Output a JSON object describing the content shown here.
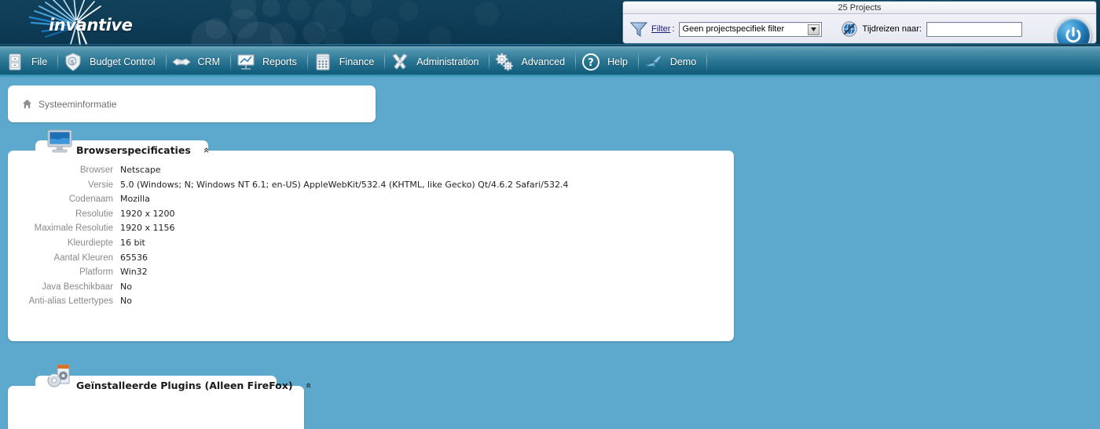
{
  "brand": {
    "name": "invantive"
  },
  "filter_panel": {
    "title": "25 Projects",
    "filter_label": "Filter",
    "colon": ":",
    "filter_value": "Geen projectspecifiek filter",
    "filter_options": [
      "Geen projectspecifiek filter"
    ],
    "timetravel_label": "Tijdreizen naar:",
    "timetravel_value": "",
    "timetravel_placeholder": "",
    "power_title": "Afsluiten"
  },
  "nav": {
    "items": [
      {
        "label": "File",
        "icon": "cabinet-icon"
      },
      {
        "label": "Budget Control",
        "icon": "money-shield-icon"
      },
      {
        "label": "CRM",
        "icon": "handshake-icon"
      },
      {
        "label": "Reports",
        "icon": "presentation-chart-icon"
      },
      {
        "label": "Finance",
        "icon": "calculator-icon"
      },
      {
        "label": "Administration",
        "icon": "tools-icon"
      },
      {
        "label": "Advanced",
        "icon": "gears-icon"
      },
      {
        "label": "Help",
        "icon": "question-circle-icon"
      },
      {
        "label": "Demo",
        "icon": "dolphin-icon"
      }
    ]
  },
  "breadcrumb": {
    "icon": "home-icon",
    "text": "Systeeminformatie"
  },
  "panels": [
    {
      "id": "browser-specs",
      "title": "Browserspecificaties",
      "icon": "monitor-icon",
      "collapse_glyph": "»",
      "rows": [
        {
          "label": "Browser",
          "value": "Netscape"
        },
        {
          "label": "Versie",
          "value": "5.0 (Windows; N; Windows NT 6.1; en-US) AppleWebKit/532.4 (KHTML, like Gecko) Qt/4.6.2 Safari/532.4"
        },
        {
          "label": "Codenaam",
          "value": "Mozilla"
        },
        {
          "label": "Resolutie",
          "value": "1920 x 1200"
        },
        {
          "label": "Maximale Resolutie",
          "value": "1920 x 1156"
        },
        {
          "label": "Kleurdiepte",
          "value": "16 bit"
        },
        {
          "label": "Aantal Kleuren",
          "value": "65536"
        },
        {
          "label": "Platform",
          "value": "Win32"
        },
        {
          "label": "Java Beschikbaar",
          "value": "No"
        },
        {
          "label": "Anti-alias Lettertypes",
          "value": "No"
        }
      ]
    },
    {
      "id": "installed-plugins",
      "title": "Geïnstalleerde Plugins (Alleen FireFox)",
      "icon": "plugin-cd-icon",
      "collapse_glyph": "»",
      "rows": []
    }
  ],
  "colors": {
    "page_background": "#5da8cd",
    "header_dark": "#0f3f5b",
    "nav_top": "#6fa7bc",
    "nav_bottom": "#0f5874",
    "panel_white": "#ffffff",
    "label_gray": "#8a8a8a",
    "link_blue": "#1b1b7a"
  }
}
